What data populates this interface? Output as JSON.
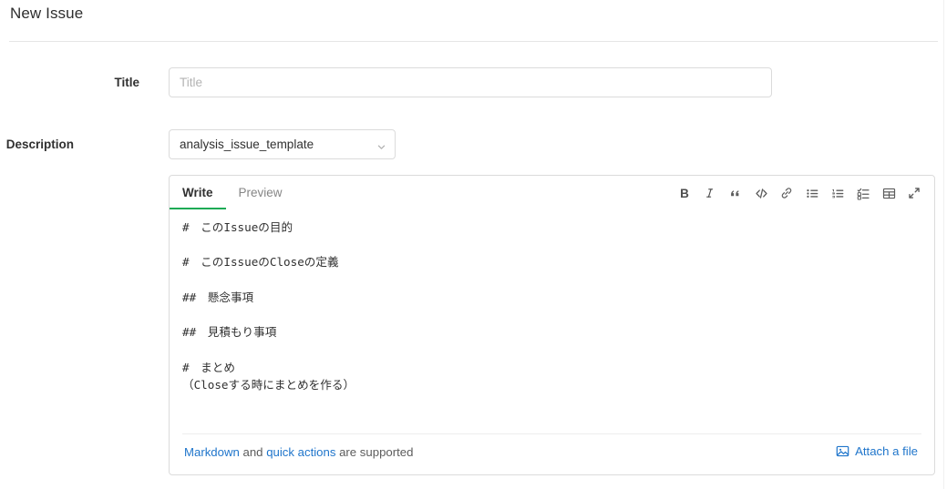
{
  "header": {
    "title": "New Issue"
  },
  "form": {
    "title_field": {
      "label": "Title",
      "placeholder": "Title",
      "value": ""
    },
    "description_field": {
      "label": "Description",
      "template_selected": "analysis_issue_template",
      "chevron_icon": "chevron-down-icon"
    }
  },
  "editor": {
    "tabs": [
      {
        "label": "Write",
        "active": true
      },
      {
        "label": "Preview",
        "active": false
      }
    ],
    "active_tab_underline_color": "#1aaa55",
    "toolbar": [
      {
        "name": "bold-icon",
        "label": "B",
        "title": "Add bold text"
      },
      {
        "name": "italic-icon",
        "label": "I",
        "title": "Add italic text"
      },
      {
        "name": "quote-icon",
        "label": "””",
        "title": "Insert a quote"
      },
      {
        "name": "code-icon",
        "label": "</>",
        "title": "Insert code"
      },
      {
        "name": "link-icon",
        "label": "",
        "title": "Add a link"
      },
      {
        "name": "bullet-list-icon",
        "label": "",
        "title": "Add a bullet list"
      },
      {
        "name": "numbered-list-icon",
        "label": "",
        "title": "Add a numbered list"
      },
      {
        "name": "task-list-icon",
        "label": "",
        "title": "Add a task list"
      },
      {
        "name": "table-icon",
        "label": "",
        "title": "Add a table"
      },
      {
        "name": "fullscreen-icon",
        "label": "",
        "title": "Go full screen"
      }
    ],
    "content": "#　このIssueの目的\n\n#　このIssueのCloseの定義\n\n##　懸念事項\n\n##　見積もり事項\n\n#　まとめ\n（Closeする時にまとめを作る）",
    "footer": {
      "markdown_link": "Markdown",
      "and_text": " and ",
      "quick_actions_link": "quick actions",
      "supported_text": " are supported",
      "attach_label": "Attach a file",
      "attach_icon": "image-file-icon"
    }
  },
  "colors": {
    "accent_green": "#1aaa55",
    "link_blue": "#1f75cb",
    "border_gray": "#dbdbdb",
    "text_dark": "#303030",
    "text_muted": "#868686"
  }
}
